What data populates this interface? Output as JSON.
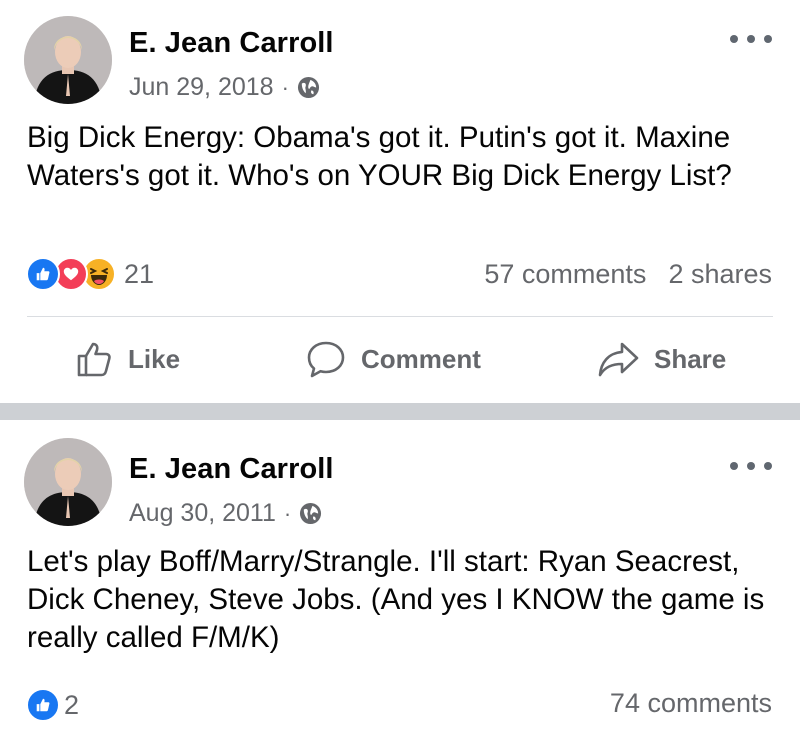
{
  "posts": [
    {
      "author": "E. Jean Carroll",
      "date": "Jun 29, 2018",
      "separator": "·",
      "text": "Big Dick Energy: Obama's got it. Putin's got it. Maxine Waters's got it. Who's on YOUR Big Dick Energy List?",
      "reaction_icons": [
        "like-icon",
        "love-icon",
        "haha-icon"
      ],
      "reaction_count": "21",
      "comments": "57 comments",
      "shares": "2 shares"
    },
    {
      "author": "E. Jean Carroll",
      "date": "Aug 30, 2011",
      "separator": "·",
      "text": "Let's play Boff/Marry/Strangle.  I'll start: Ryan Seacrest, Dick Cheney, Steve Jobs.  (And yes I KNOW the game is really called F/M/K)",
      "reaction_icons": [
        "like-icon"
      ],
      "reaction_count": "2",
      "comments": "74 comments"
    }
  ],
  "actions": {
    "like": "Like",
    "comment": "Comment",
    "share": "Share"
  },
  "colors": {
    "like_blue": "#1877f2",
    "love_red": "#f33e58",
    "haha_yellow": "#f7b125",
    "secondary_text": "#65676b",
    "separator_band": "#cdd0d4"
  }
}
